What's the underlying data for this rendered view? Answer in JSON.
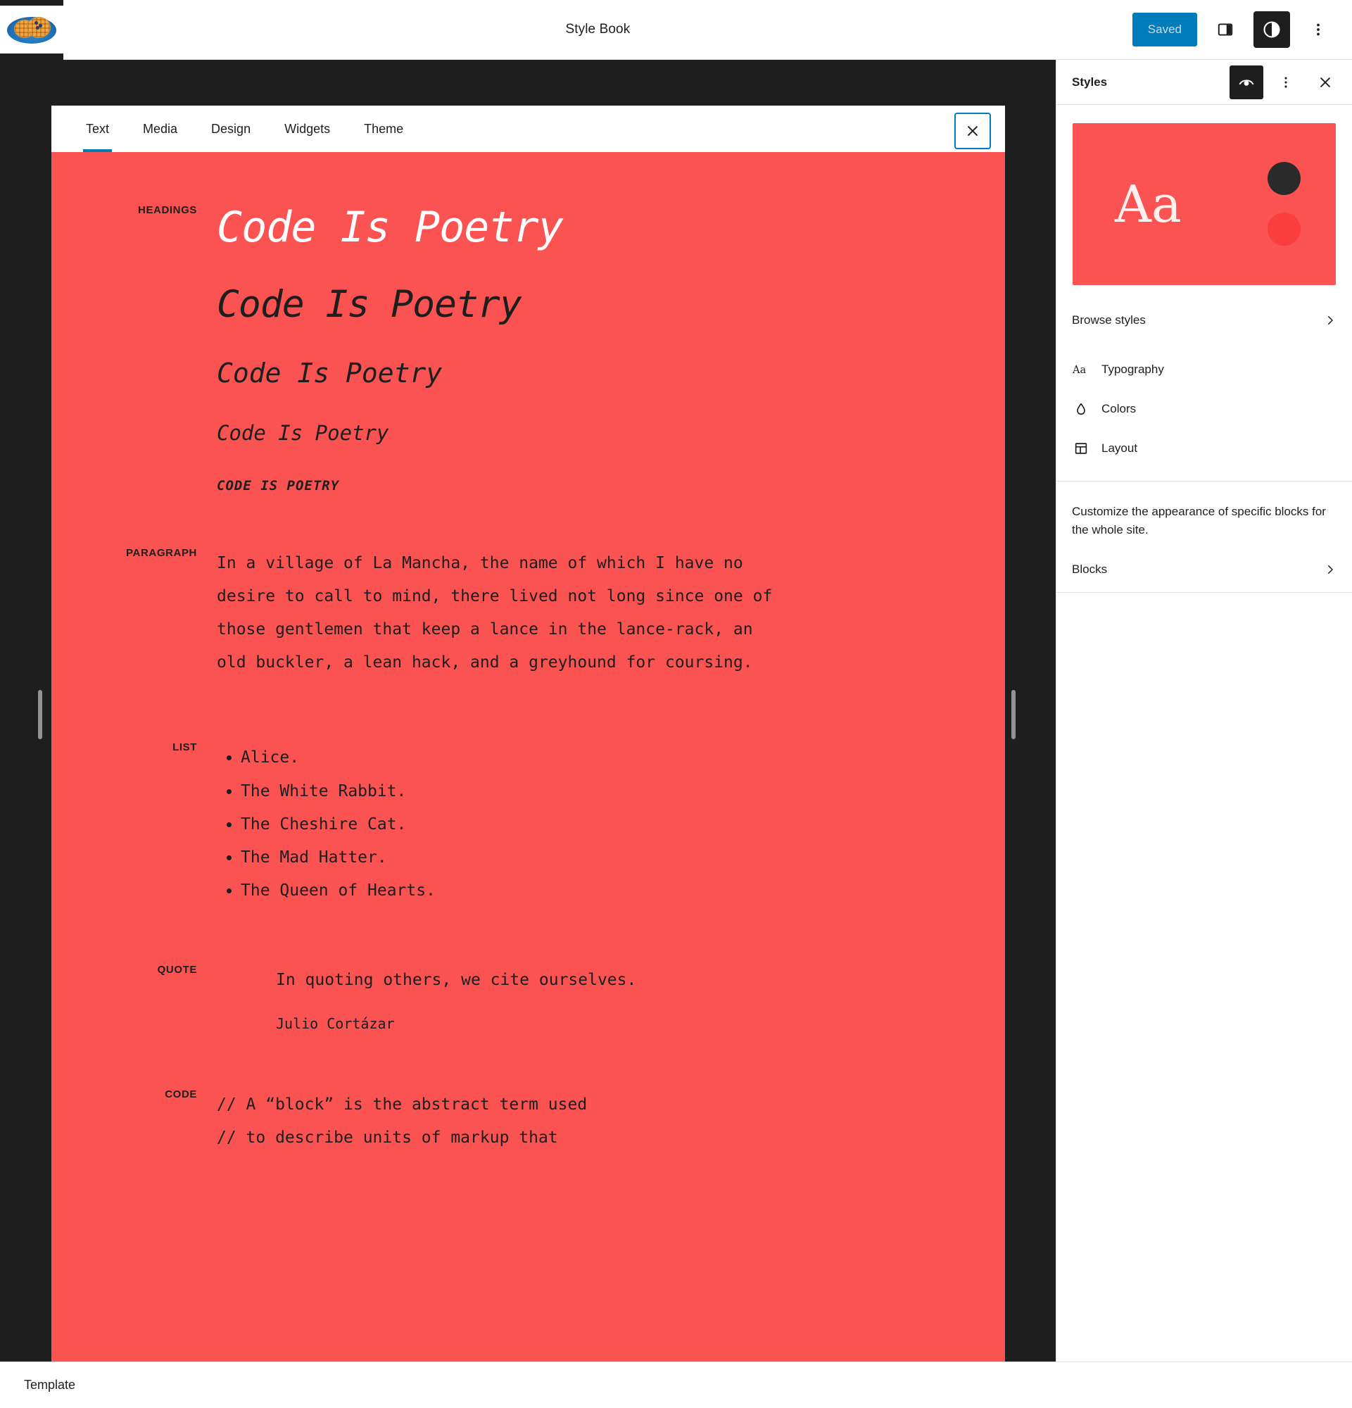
{
  "header": {
    "title": "Style Book",
    "site_icon_name": "site-icon-waffles",
    "saved_label": "Saved",
    "sidebar_toggle_icon": "sidebar-panel-icon",
    "styles_toggle_icon": "contrast-circle-icon",
    "options_icon": "kebab-menu-icon"
  },
  "stylebook": {
    "tabs": [
      {
        "label": "Text",
        "active": true
      },
      {
        "label": "Media",
        "active": false
      },
      {
        "label": "Design",
        "active": false
      },
      {
        "label": "Widgets",
        "active": false
      },
      {
        "label": "Theme",
        "active": false
      }
    ],
    "close_icon": "close-icon",
    "background_color": "#fb5252",
    "sections": {
      "headings": {
        "label": "HEADINGS",
        "items": [
          "Code Is Poetry",
          "Code Is Poetry",
          "Code Is Poetry",
          "Code Is Poetry",
          "Code Is Poetry"
        ]
      },
      "paragraph": {
        "label": "PARAGRAPH",
        "text": "In a village of La Mancha, the name of which I have no desire to call to mind, there lived not long since one of those gentlemen that keep a lance in the lance-rack, an old buckler, a lean hack, and a greyhound for coursing."
      },
      "list": {
        "label": "LIST",
        "items": [
          "Alice.",
          "The White Rabbit.",
          "The Cheshire Cat.",
          "The Mad Hatter.",
          "The Queen of Hearts."
        ]
      },
      "quote": {
        "label": "QUOTE",
        "text": "In quoting others, we cite ourselves.",
        "citation": "Julio Cortázar"
      },
      "code": {
        "label": "CODE",
        "line1": "// A “block” is the abstract term used",
        "line2": "// to describe units of markup that"
      }
    }
  },
  "styles_panel": {
    "title": "Styles",
    "preview_icon_btn": "style-preview-eye-icon",
    "more_icon": "kebab-menu-icon",
    "close_icon": "close-icon",
    "preview": {
      "aa_text": "Aa",
      "background_color": "#fb5252",
      "dot_dark": "#2b2a2a",
      "dot_red": "#fa3d3d"
    },
    "browse": {
      "label": "Browse styles",
      "chevron": "chevron-right-icon"
    },
    "nav": [
      {
        "label": "Typography",
        "icon": "typography-aa-icon"
      },
      {
        "label": "Colors",
        "icon": "color-drop-icon"
      },
      {
        "label": "Layout",
        "icon": "layout-grid-icon"
      }
    ],
    "description": "Customize the appearance of specific blocks for the whole site.",
    "blocks": {
      "label": "Blocks",
      "chevron": "chevron-right-icon"
    }
  },
  "footer": {
    "label": "Template"
  }
}
